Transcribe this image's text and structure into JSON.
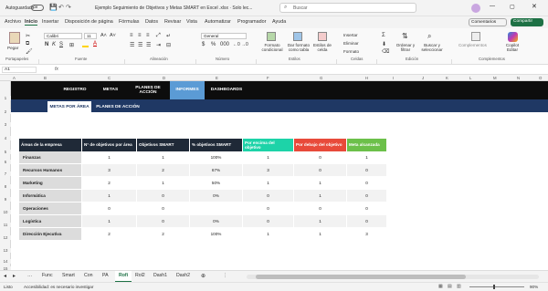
{
  "window": {
    "autosave_label": "Autoguardado",
    "autosave_state": "Off",
    "file_title": "Ejemplo Seguimiento de Objetivos y Metas SMART en Excel .xlsx  ·  Solo lec...",
    "search_placeholder": "Buscar"
  },
  "menu": {
    "items": [
      "Archivo",
      "Inicio",
      "Insertar",
      "Disposición de página",
      "Fórmulas",
      "Datos",
      "Revisar",
      "Vista",
      "Automatizar",
      "Programador",
      "Ayuda"
    ],
    "active": "Inicio",
    "comments_label": "Comentarios",
    "share_label": "Compartir"
  },
  "ribbon": {
    "paste_label": "Pegar",
    "font_name": "Calibri",
    "font_size": "11",
    "number_format": "General",
    "cond_format_label": "Formato condicional",
    "table_format_label": "Dar formato como tabla",
    "cell_styles_label": "Estilos de celda",
    "insert_label": "Insertar",
    "delete_label": "Eliminar",
    "format_label": "Formato",
    "sort_filter_label": "Ordenar y filtrar",
    "find_select_label": "Buscar y seleccionar",
    "addins_label": "Complementos",
    "copilot_label": "Copilot Editar",
    "groups": [
      "Portapapeles",
      "Fuente",
      "Alineación",
      "Número",
      "Estilos",
      "Celdas",
      "Edición",
      "Complementos"
    ],
    "accent_color": "#1e7145"
  },
  "formula_bar": {
    "cell_ref": "A1",
    "fx": "fx",
    "value": ""
  },
  "grid": {
    "columns": [
      "A",
      "B",
      "C",
      "D",
      "E",
      "F",
      "G",
      "H",
      "I",
      "J",
      "K",
      "L",
      "M",
      "N",
      "O"
    ],
    "rows": [
      "1",
      "2",
      "3",
      "4",
      "5",
      "6",
      "7",
      "8",
      "9",
      "10",
      "11",
      "12",
      "13",
      "14",
      "15"
    ]
  },
  "nav": {
    "buttons": [
      "REGISTRO",
      "METAS",
      "PLANES DE ACCIÓN",
      "INFORMES",
      "DASHBOARDS"
    ],
    "active": "INFORMES",
    "subtabs": [
      "METAS POR ÁREA",
      "PLANES DE ACCIÓN"
    ],
    "active_subtab": "METAS POR ÁREA"
  },
  "table": {
    "headers": [
      "Áreas de la empresa",
      "N° de objetivos por área",
      "Objetivos SMART",
      "% objetivos SMART",
      "Por encima del objetivo",
      "Por debajo del objetivo",
      "Meta alcanzada"
    ],
    "rows": [
      [
        "Finanzas",
        "1",
        "1",
        "100%",
        "1",
        "0",
        "1"
      ],
      [
        "Recursos Humanos",
        "3",
        "2",
        "67%",
        "3",
        "0",
        "0"
      ],
      [
        "Marketing",
        "2",
        "1",
        "50%",
        "1",
        "1",
        "0"
      ],
      [
        "Informática",
        "1",
        "0",
        "0%",
        "0",
        "1",
        "0"
      ],
      [
        "Operaciones",
        "0",
        "0",
        "",
        "0",
        "0",
        "0"
      ],
      [
        "Logística",
        "1",
        "0",
        "0%",
        "0",
        "1",
        "0"
      ],
      [
        "Dirección Ejecutiva",
        "2",
        "2",
        "100%",
        "1",
        "1",
        "3"
      ]
    ]
  },
  "colors": {
    "header_dark": "#1f2937",
    "above_green": "#1dd3a8",
    "below_red": "#e84a3a",
    "reached_green": "#6cc04a",
    "nav_active": "#5b9bd5",
    "banner_navy": "#1f3864"
  },
  "sheet_tabs": [
    "Func",
    "Smart",
    "Con",
    "PA",
    "Rofi",
    "Rol2",
    "Dash1",
    "Dash2"
  ],
  "active_sheet": "Rofi",
  "status": {
    "ready": "Listo",
    "accessibility": "Accesibilidad: es necesario investigar",
    "zoom": "90%"
  }
}
